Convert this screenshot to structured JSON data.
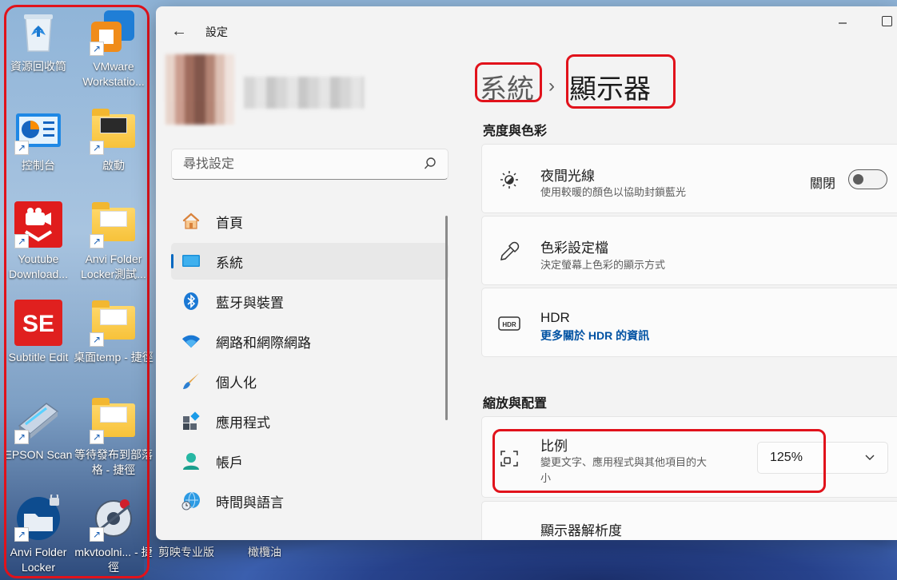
{
  "desktop": {
    "icons": [
      {
        "label": "資源回收筒",
        "icon": "recycle-bin-icon"
      },
      {
        "label": "VMware Workstatio...",
        "icon": "vmware-icon"
      },
      {
        "label": "控制台",
        "icon": "control-panel-icon"
      },
      {
        "label": "啟動",
        "icon": "folder-icon"
      },
      {
        "label": "Youtube Download...",
        "icon": "youtube-downloader-icon"
      },
      {
        "label": "Anvi Folder Locker測試...",
        "icon": "folder-icon"
      },
      {
        "label": "Subtitle Edit",
        "icon": "subtitle-edit-icon"
      },
      {
        "label": "桌面temp - 捷徑",
        "icon": "folder-icon"
      },
      {
        "label": "EPSON Scan",
        "icon": "scanner-icon"
      },
      {
        "label": "等待發布到部落格 - 捷徑",
        "icon": "folder-icon"
      },
      {
        "label": "Anvi Folder Locker",
        "icon": "anvi-folder-locker-icon"
      },
      {
        "label": "mkvtoolni... - 捷徑",
        "icon": "mkvtoolnix-icon"
      }
    ],
    "below_window_labels": [
      "剪映专业版",
      "橄欖油"
    ]
  },
  "window": {
    "app_title": "設定",
    "nav": {
      "search_placeholder": "尋找設定",
      "items": [
        {
          "label": "首頁",
          "icon": "home-icon"
        },
        {
          "label": "系統",
          "icon": "system-icon"
        },
        {
          "label": "藍牙與裝置",
          "icon": "bluetooth-icon"
        },
        {
          "label": "網路和網際網路",
          "icon": "wifi-icon"
        },
        {
          "label": "個人化",
          "icon": "brush-icon"
        },
        {
          "label": "應用程式",
          "icon": "apps-icon"
        },
        {
          "label": "帳戶",
          "icon": "account-icon"
        },
        {
          "label": "時間與語言",
          "icon": "time-language-icon"
        }
      ]
    },
    "breadcrumb": {
      "parent": "系統",
      "separator": "›",
      "current": "顯示器"
    },
    "sections": {
      "brightness": "亮度與色彩",
      "scale_layout": "縮放與配置"
    },
    "cards": {
      "night_light": {
        "title": "夜間光線",
        "subtitle": "使用較暖的顏色以協助封鎖藍光",
        "state": "關閉",
        "icon": "brightness-icon"
      },
      "color_profile": {
        "title": "色彩設定檔",
        "subtitle": "決定螢幕上色彩的顯示方式",
        "icon": "eyedropper-icon"
      },
      "hdr": {
        "title": "HDR",
        "link": "更多關於 HDR 的資訊",
        "icon": "hdr-icon"
      },
      "scale": {
        "title": "比例",
        "subtitle_line1": "變更文字、應用程式與其他項目的大",
        "subtitle_line2": "小",
        "value": "125%",
        "icon": "scale-icon"
      },
      "resolution": {
        "title": "顯示器解析度"
      }
    },
    "colors": {
      "accent": "#0067c0",
      "highlight": "#e1121b"
    }
  }
}
